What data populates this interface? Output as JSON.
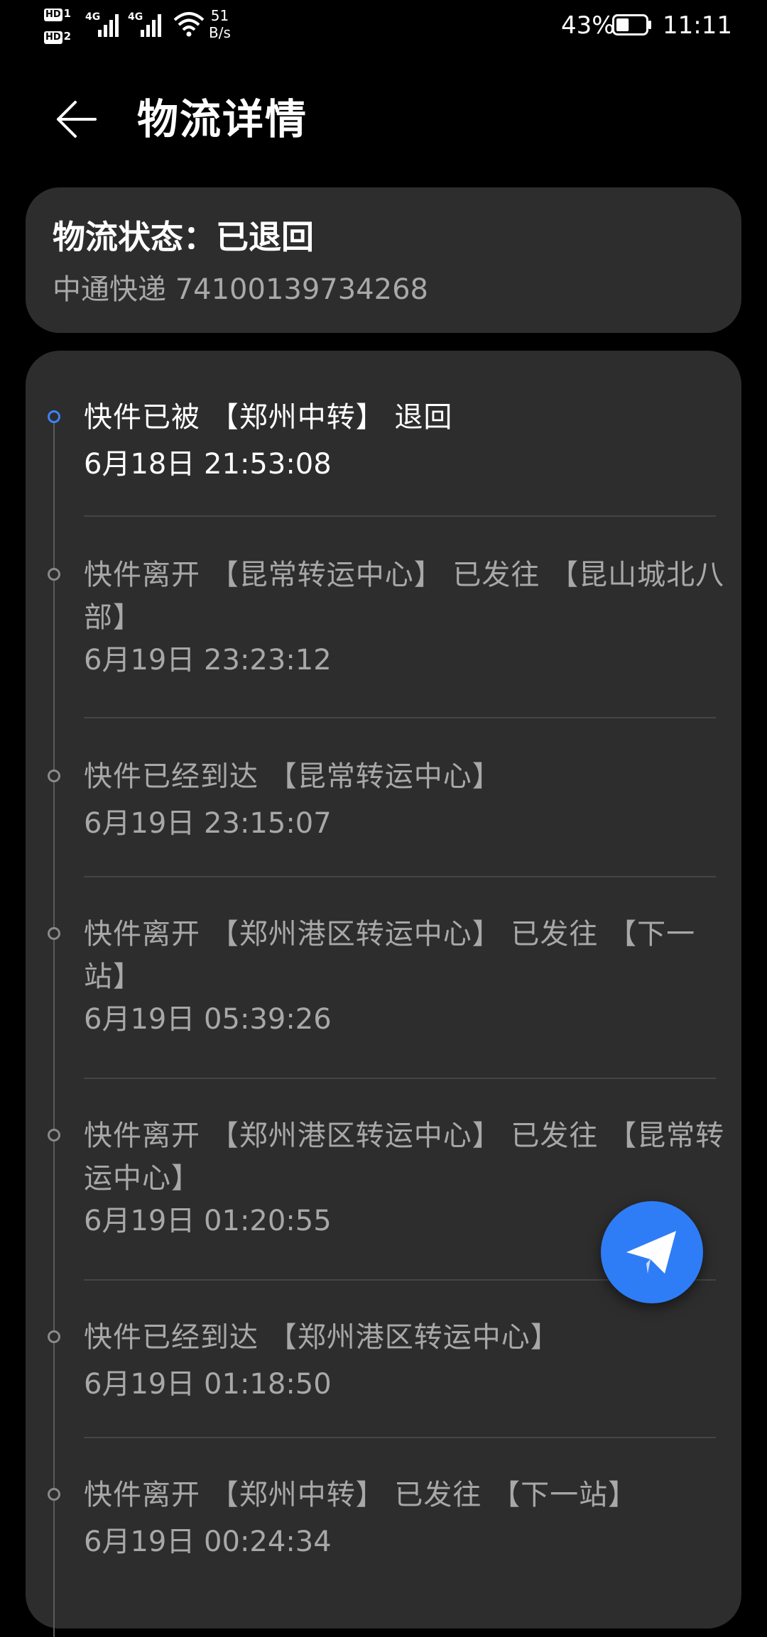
{
  "status_bar": {
    "hd1": "HD",
    "hd1_num": "1",
    "hd2": "HD",
    "hd2_num": "2",
    "net1": "4G",
    "net2": "4G",
    "speed_value": "51",
    "speed_unit": "B/s",
    "battery_percent": "43%",
    "battery_level": 0.43,
    "time": "11:11"
  },
  "header": {
    "title": "物流详情",
    "back_icon": "arrow-left-icon"
  },
  "status_card": {
    "title": "物流状态：已退回",
    "carrier_tracking": "中通快递 74100139734268"
  },
  "timeline": {
    "active_color": "#3d82f5",
    "events": [
      {
        "text": "快件已被 【郑州中转】 退回",
        "time": "6月18日 21:53:08"
      },
      {
        "text": "快件离开 【昆常转运中心】 已发往 【昆山城北八部】",
        "time": "6月19日 23:23:12"
      },
      {
        "text": "快件已经到达 【昆常转运中心】",
        "time": "6月19日 23:15:07"
      },
      {
        "text": "快件离开 【郑州港区转运中心】 已发往 【下一站】",
        "time": "6月19日 05:39:26"
      },
      {
        "text": "快件离开 【郑州港区转运中心】 已发往 【昆常转运中心】",
        "time": "6月19日 01:20:55"
      },
      {
        "text": "快件已经到达 【郑州港区转运中心】",
        "time": "6月19日 01:18:50"
      },
      {
        "text": "快件离开 【郑州中转】 已发往 【下一站】",
        "time": "6月19日 00:24:34"
      }
    ]
  },
  "fab": {
    "icon": "paper-plane-icon",
    "color": "#2f7df6"
  }
}
